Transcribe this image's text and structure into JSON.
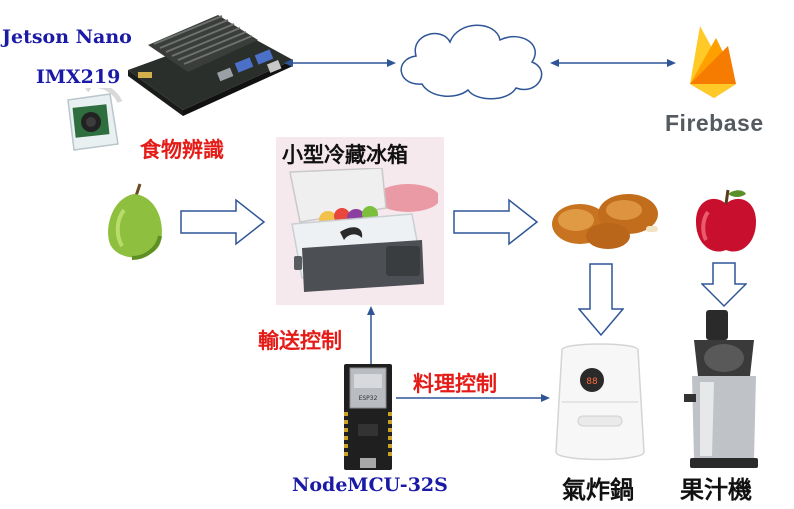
{
  "labels": {
    "jetson": "Jetson Nano",
    "camera": "IMX219",
    "food_recognition": "食物辨識",
    "fridge": "小型冷藏冰箱",
    "conveyor_control": "輸送控制",
    "cooking_control": "料理控制",
    "mcu": "NodeMCU-32S",
    "air_fryer": "氣炸鍋",
    "juicer": "果汁機",
    "firebase": "Firebase"
  },
  "colors": {
    "blue_label": "#1a1aa6",
    "red_label": "#e41b17",
    "arrow_outline": "#2f5597",
    "firebase_yellow": "#ffca28",
    "firebase_orange": "#f57c00",
    "firebase_amber": "#ffa000"
  },
  "icons": [
    "jetson-nano-board-icon",
    "camera-module-icon",
    "cloud-icon",
    "firebase-flame-icon",
    "guava-icon",
    "fridge-icon",
    "fried-chicken-icon",
    "apple-icon",
    "esp32-board-icon",
    "air-fryer-icon",
    "juicer-icon"
  ]
}
